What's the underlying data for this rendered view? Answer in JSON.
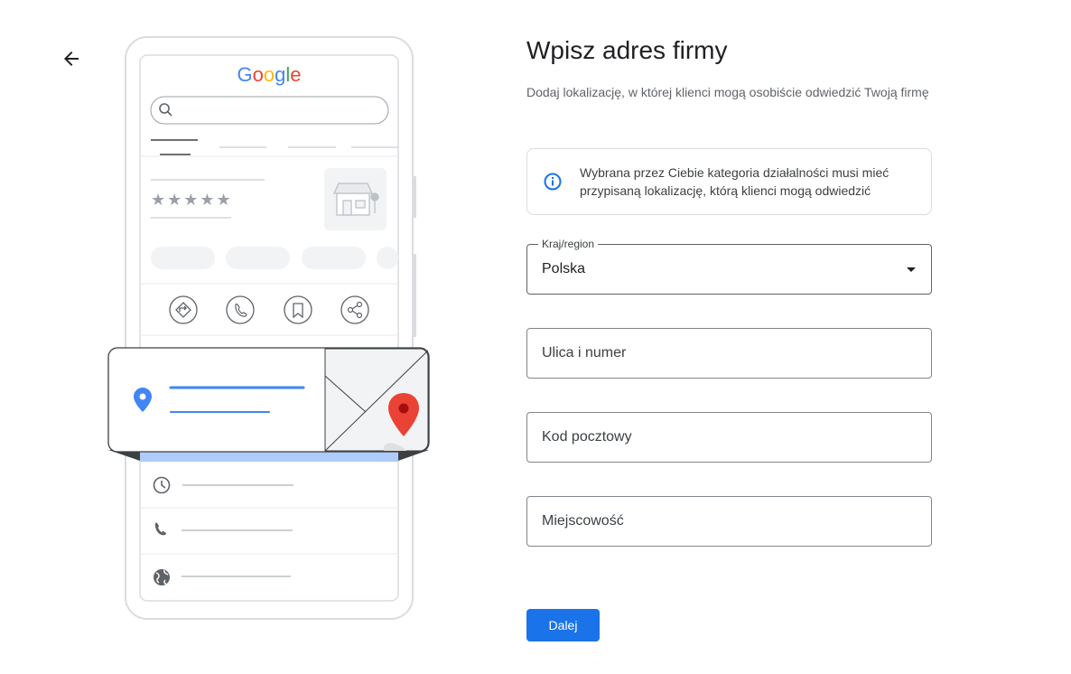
{
  "header": {
    "title": "Wpisz adres firmy",
    "subtitle": "Dodaj lokalizację, w której klienci mogą osobiście odwiedzić Twoją firmę"
  },
  "illustration": {
    "logo_text": "Google",
    "rating_stars": "★★★★★",
    "logo_colors": [
      "#4285F4",
      "#EA4335",
      "#FBBC05",
      "#4285F4",
      "#34A853",
      "#EA4335"
    ]
  },
  "info": {
    "text": "Wybrana przez Ciebie kategoria działalności musi mieć przypisaną lokalizację, którą klienci mogą odwiedzić",
    "icon": "info-icon",
    "color": "#1a73e8"
  },
  "form": {
    "country": {
      "label": "Kraj/region",
      "value": "Polska"
    },
    "street": {
      "placeholder": "Ulica i numer"
    },
    "postal": {
      "placeholder": "Kod pocztowy"
    },
    "city": {
      "placeholder": "Miejscowość"
    }
  },
  "actions": {
    "next_label": "Dalej",
    "primary_color": "#1a73e8"
  }
}
